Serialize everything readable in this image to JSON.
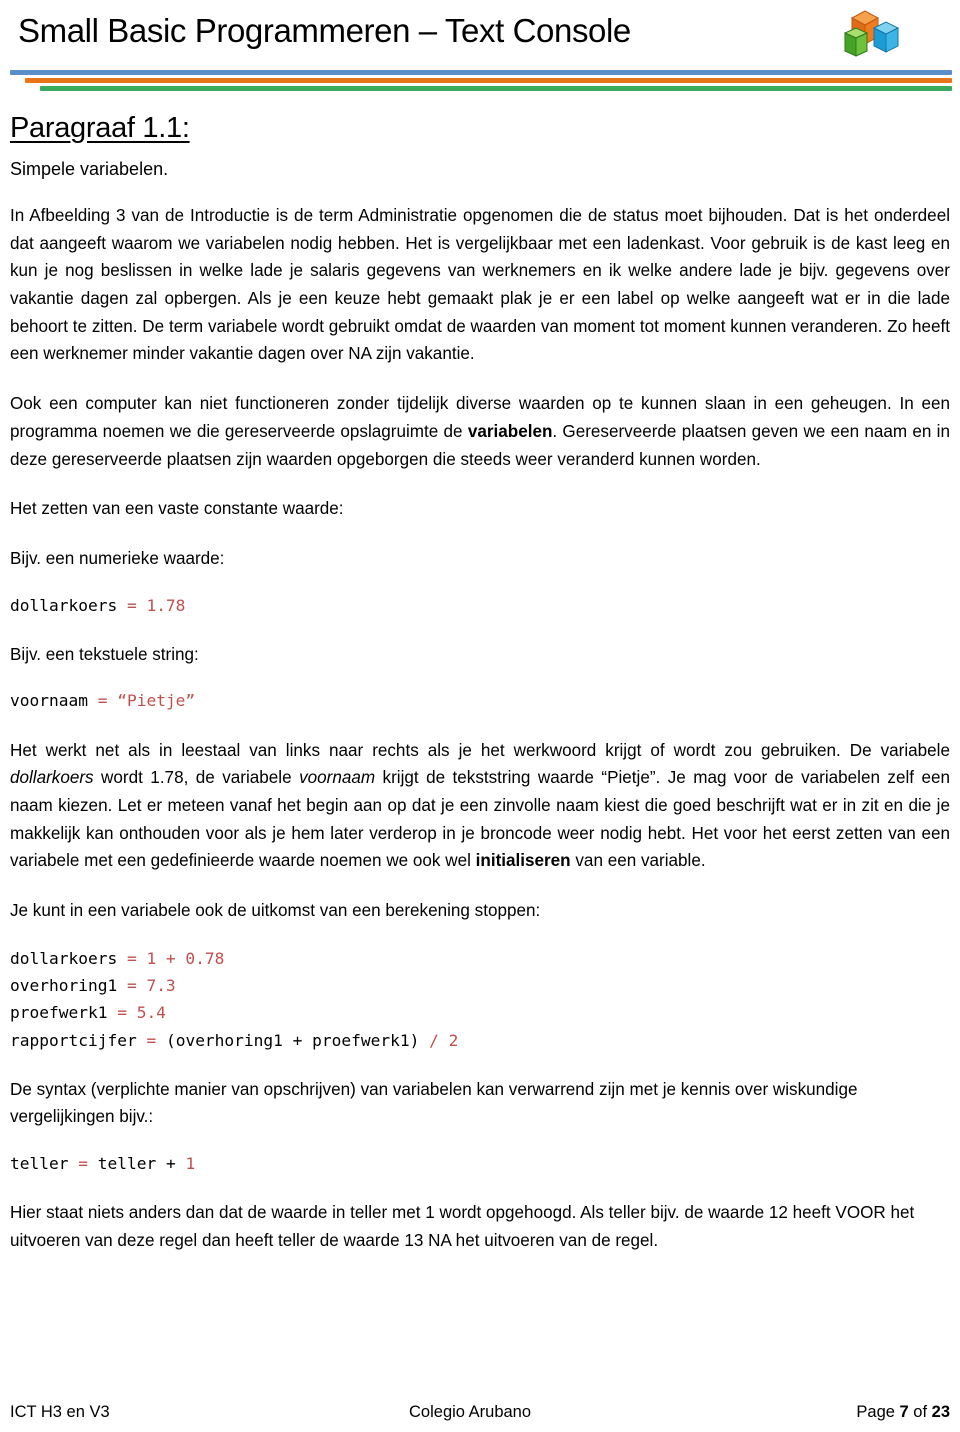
{
  "header": {
    "title": "Small Basic Programmeren – Text Console",
    "logo_name": "small-basic-cubes-logo",
    "rule_colors": {
      "blue": "#5B8DC8",
      "orange": "#E8751A",
      "green": "#3AAA5D"
    }
  },
  "headings": {
    "paragraph_number": "Paragraaf 1.1:",
    "subtitle": "Simpele variabelen."
  },
  "paragraphs": {
    "p1_part1": "In Afbeelding 3 van de Introductie is de term Administratie opgenomen die de status moet bijhouden. Dat is het onderdeel dat aangeeft waarom we variabelen nodig hebben. Het is vergelijkbaar met een ladenkast. Voor gebruik is de kast leeg en kun je nog beslissen in welke lade je salaris gegevens van werknemers en ik welke andere lade je bijv. gegevens over vakantie dagen zal opbergen. Als je een keuze hebt gemaakt plak je er een label op welke aangeeft wat er in die lade behoort te zitten. De term variabele wordt gebruikt omdat de waarden van moment tot moment kunnen veranderen. Zo heeft een werknemer minder vakantie dagen over NA zijn vakantie.",
    "p2_a": "Ook een computer kan niet functioneren zonder tijdelijk diverse waarden op te kunnen slaan in een geheugen. In een programma noemen we die gereserveerde  opslagruimte de ",
    "p2_bold": "variabelen",
    "p2_b": ". Gereserveerde plaatsen geven we een naam en in deze gereserveerde plaatsen zijn waarden opgeborgen die steeds weer veranderd kunnen worden.",
    "p3": "Het zetten van een vaste constante waarde:",
    "p4": "Bijv. een numerieke waarde:",
    "p5": "Bijv. een tekstuele string:",
    "p6_a": "Het werkt net als in leestaal van links naar rechts als je het werkwoord krijgt of wordt zou gebruiken. De variabele ",
    "p6_i1": "dollarkoers",
    "p6_b": " wordt 1.78,  de variabele ",
    "p6_i2": "voornaam",
    "p6_c": " krijgt de tekststring waarde “Pietje”. Je mag voor de variabelen zelf een naam kiezen. Let er meteen vanaf het begin aan op dat je een zinvolle naam kiest die goed beschrijft wat er in zit en die je makkelijk kan onthouden voor als je hem later verderop in je broncode weer nodig hebt. Het voor het eerst zetten van een variabele met een gedefinieerde waarde noemen we ook wel ",
    "p6_bold": "initialiseren",
    "p6_d": " van een variable.",
    "p7": "Je kunt in een variabele ook de uitkomst van een berekening stoppen:",
    "p8": "De syntax (verplichte manier van opschrijven) van variabelen kan verwarrend zijn met je kennis over wiskundige vergelijkingen bijv.:",
    "p9": "Hier staat niets anders dan dat de waarde in teller met 1 wordt opgehoogd. Als teller bijv. de waarde 12 heeft VOOR het uitvoeren van deze regel  dan heeft teller de waarde 13 NA het uitvoeren van de regel."
  },
  "code": {
    "accent_color": "#C0504D",
    "snippet_dollarkoers": {
      "name": "dollarkoers ",
      "assign": "= 1.78"
    },
    "snippet_voornaam": {
      "name": "voornaam ",
      "assign": "= “Pietje”"
    },
    "block_calc": {
      "line1_name": "dollarkoers ",
      "line1_value": "= 1 + 0.78",
      "line2_name": "overhoring1 ",
      "line2_value": "= 7.3",
      "line3_name": "proefwerk1 ",
      "line3_value": "= 5.4",
      "line4_name": "rapportcijfer ",
      "line4_eq": "= ",
      "line4_expr": "(overhoring1 + proefwerk1) ",
      "line4_tail": "/ 2"
    },
    "snippet_teller": {
      "part1": "teller ",
      "eq": "= ",
      "part2": "teller + ",
      "value": "1"
    }
  },
  "footer": {
    "left": "ICT H3 en V3",
    "center": "Colegio Arubano",
    "right_prefix": "Page ",
    "right_page": "7",
    "right_middle": " of ",
    "right_total": "23"
  }
}
